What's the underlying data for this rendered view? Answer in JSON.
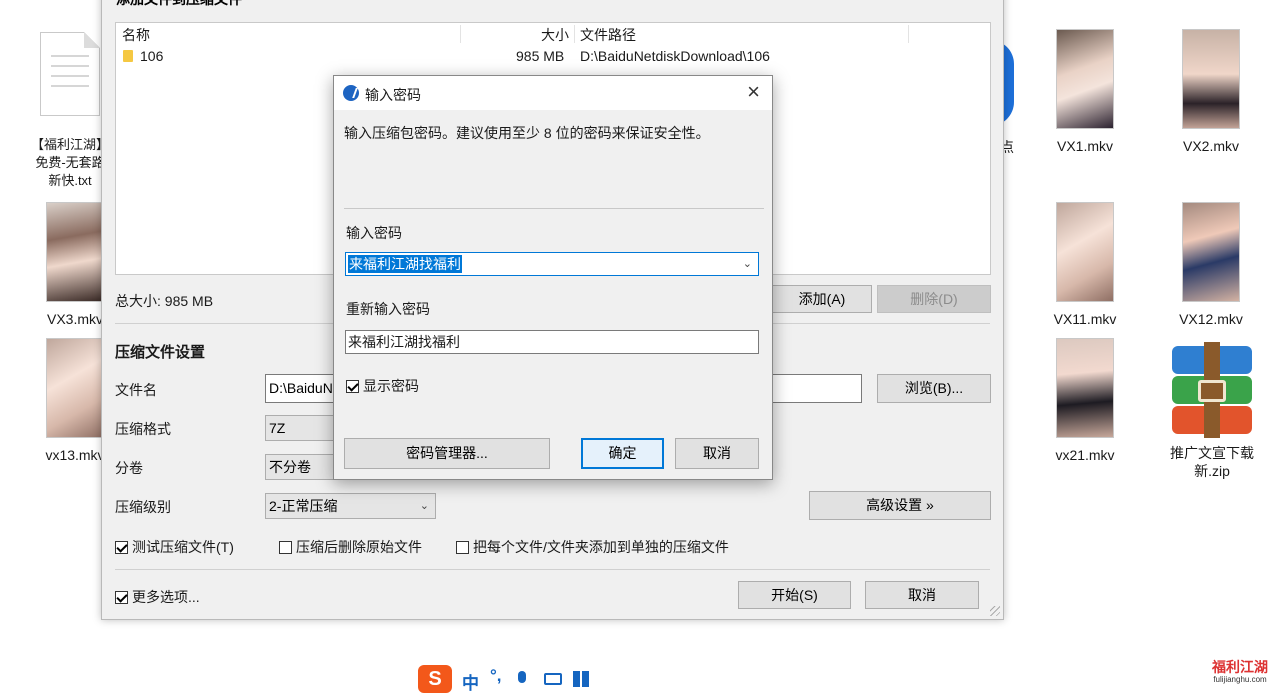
{
  "desktop": {
    "icons": [
      {
        "label": "【福利江湖】\n免费-无套路\n新快.txt"
      },
      {
        "label": "VX3.mkv"
      },
      {
        "label": "vx13.mkv"
      },
      {
        "label": "VX1.mkv"
      },
      {
        "label": "VX2.mkv"
      },
      {
        "label": "VX11.mkv"
      },
      {
        "label": "VX12.mkv"
      },
      {
        "label": "vx21.mkv"
      },
      {
        "label": "推广文宣下载新.zip"
      }
    ],
    "partial_label": "点"
  },
  "main_window": {
    "title": "添加文件到压缩文件",
    "columns": {
      "name": "名称",
      "size": "大小",
      "path": "文件路径"
    },
    "rows": [
      {
        "name": "106",
        "size": "985 MB",
        "path": "D:\\BaiduNetdiskDownload\\106"
      }
    ],
    "total_size": "总大小: 985 MB",
    "add_button": "添加(A)",
    "delete_button": "删除(D)",
    "settings_title": "压缩文件设置",
    "filename_label": "文件名",
    "filename_value": "D:\\BaiduN",
    "browse_button": "浏览(B)...",
    "format_label": "压缩格式",
    "format_value": "7Z",
    "split_label": "分卷",
    "split_value": "不分卷",
    "level_label": "压缩级别",
    "level_value": "2-正常压缩",
    "advanced_button": "高级设置 »",
    "test_checkbox": "测试压缩文件(T)",
    "delete_after_checkbox": "压缩后删除原始文件",
    "separate_checkbox": "把每个文件/文件夹添加到单独的压缩文件",
    "more_options_checkbox": "更多选项...",
    "start_button": "开始(S)",
    "cancel_button": "取消"
  },
  "password_dialog": {
    "title": "输入密码",
    "description": "输入压缩包密码。建议使用至少 8 位的密码来保证安全性。",
    "password_label": "输入密码",
    "password_value": "来福利江湖找福利",
    "reenter_label": "重新输入密码",
    "reenter_value": "来福利江湖找福利",
    "show_password": "显示密码",
    "manager_button": "密码管理器...",
    "ok_button": "确定",
    "cancel_button": "取消"
  },
  "ime": {
    "mode": "中"
  },
  "watermark": {
    "title": "福利江湖",
    "url": "fulijianghu.com"
  }
}
